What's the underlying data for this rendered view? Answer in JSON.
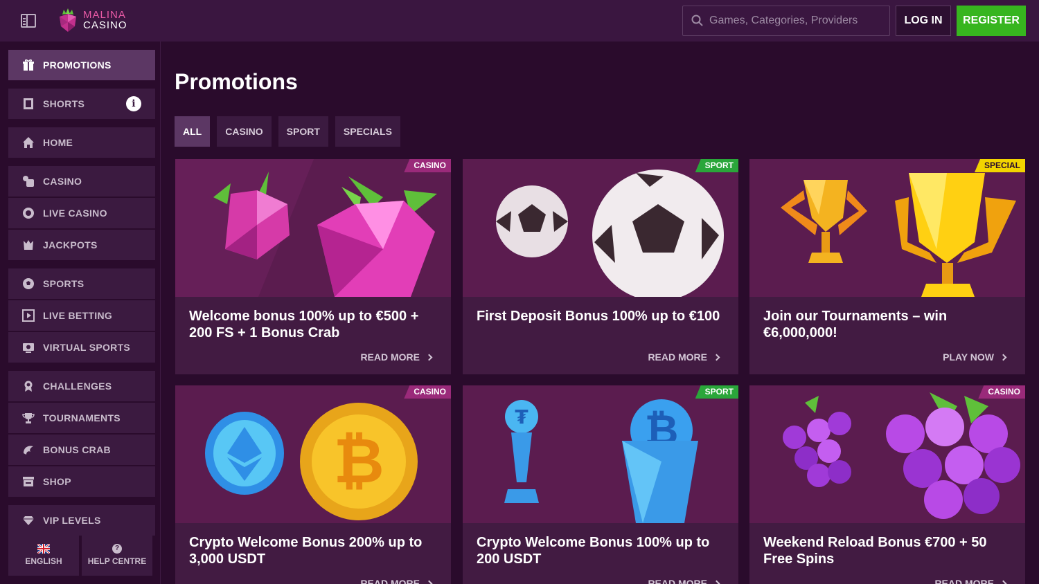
{
  "header": {
    "logo_line1": "MALINA",
    "logo_line2": "CASINO",
    "search_placeholder": "Games, Categories, Providers",
    "login_label": "LOG IN",
    "register_label": "REGISTER"
  },
  "sidebar": {
    "items": [
      {
        "label": "PROMOTIONS",
        "icon": "gift-icon"
      },
      {
        "label": "SHORTS",
        "icon": "film-icon"
      },
      {
        "label": "HOME",
        "icon": "home-icon"
      },
      {
        "label": "CASINO",
        "icon": "dice-icon"
      },
      {
        "label": "LIVE CASINO",
        "icon": "chip-icon"
      },
      {
        "label": "JACKPOTS",
        "icon": "jackpot-icon"
      },
      {
        "label": "SPORTS",
        "icon": "soccer-ball-icon"
      },
      {
        "label": "LIVE BETTING",
        "icon": "live-icon"
      },
      {
        "label": "VIRTUAL SPORTS",
        "icon": "virtual-icon"
      },
      {
        "label": "CHALLENGES",
        "icon": "medal-icon"
      },
      {
        "label": "TOURNAMENTS",
        "icon": "trophy-icon"
      },
      {
        "label": "BONUS CRAB",
        "icon": "crab-icon"
      },
      {
        "label": "SHOP",
        "icon": "shop-icon"
      },
      {
        "label": "VIP LEVELS",
        "icon": "diamond-icon"
      }
    ],
    "language_label": "ENGLISH",
    "help_label": "HELP CENTRE"
  },
  "main": {
    "title": "Promotions",
    "tabs": [
      "ALL",
      "CASINO",
      "SPORT",
      "SPECIALS"
    ],
    "cards": [
      {
        "badge": "CASINO",
        "title": "Welcome bonus 100% up to €500 + 200 FS + 1 Bonus Crab",
        "link": "READ MORE"
      },
      {
        "badge": "SPORT",
        "title": "First Deposit Bonus 100% up to €100",
        "link": "READ MORE"
      },
      {
        "badge": "SPECIAL",
        "title": "Join our Tournaments – win €6,000,000!",
        "link": "PLAY NOW"
      },
      {
        "badge": "CASINO",
        "title": "Crypto Welcome Bonus 200% up to 3,000 USDT",
        "link": "READ MORE"
      },
      {
        "badge": "SPORT",
        "title": "Crypto Welcome Bonus 100% up to 200 USDT",
        "link": "READ MORE"
      },
      {
        "badge": "CASINO",
        "title": "Weekend Reload Bonus €700 + 50 Free Spins",
        "link": "READ MORE"
      }
    ]
  },
  "colors": {
    "background": "#2a0b2c",
    "header": "#3a1640",
    "register": "#37b51f",
    "badge_casino": "#9a2a7a",
    "badge_sport": "#2aa63a",
    "badge_special": "#f2d400"
  }
}
